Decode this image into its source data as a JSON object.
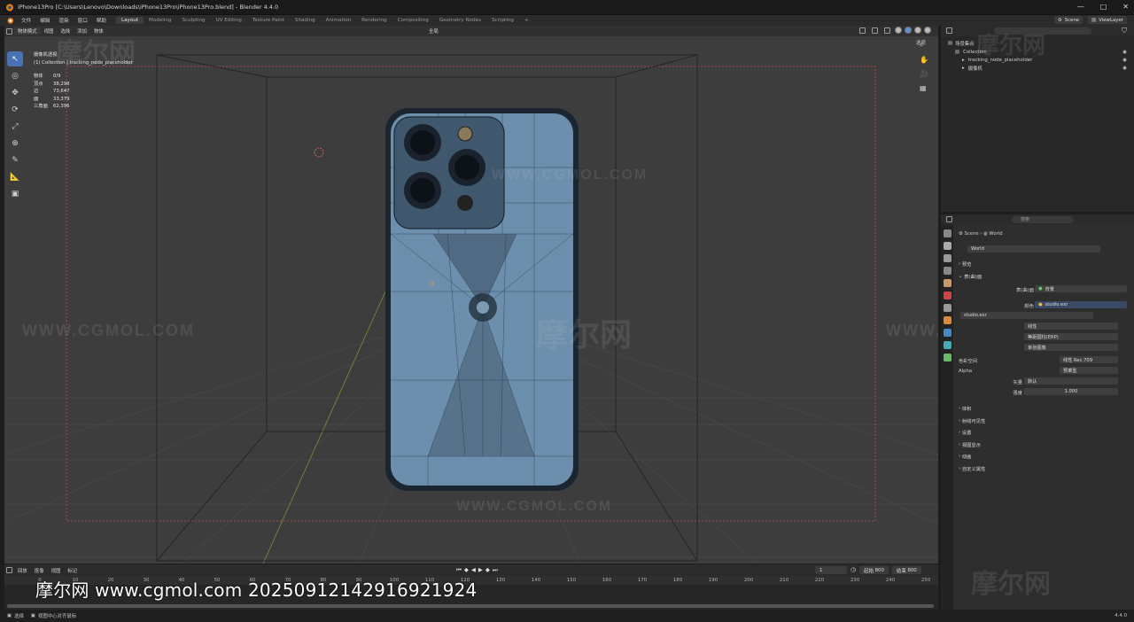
{
  "window": {
    "title": "iPhone13Pro [C:\\Users\\Lenovo\\Downloads\\iPhone13Pro\\iPhone13Pro.blend] - Blender 4.4.0",
    "controls": [
      "—",
      "□",
      "✕"
    ]
  },
  "menubar": {
    "items": [
      "文件",
      "编辑",
      "渲染",
      "窗口",
      "帮助"
    ],
    "workspaces": [
      {
        "label": "Layout",
        "active": true
      },
      {
        "label": "Modeling",
        "active": false
      },
      {
        "label": "Sculpting",
        "active": false
      },
      {
        "label": "UV Editing",
        "active": false
      },
      {
        "label": "Texture Paint",
        "active": false
      },
      {
        "label": "Shading",
        "active": false
      },
      {
        "label": "Animation",
        "active": false
      },
      {
        "label": "Rendering",
        "active": false
      },
      {
        "label": "Compositing",
        "active": false
      },
      {
        "label": "Geometry Nodes",
        "active": false
      },
      {
        "label": "Scripting",
        "active": false
      }
    ],
    "add_tab": "+",
    "scene": "Scene",
    "view_layer": "ViewLayer"
  },
  "viewport_header": {
    "mode": "物体模式",
    "menus": [
      "视图",
      "选择",
      "添加",
      "物体"
    ],
    "transform": "全局",
    "overlay_label": "选项"
  },
  "viewport_info": {
    "line1": "摄像机透视",
    "line2": "(1) Collection | tracking_node_placeholder",
    "stats": [
      {
        "k": "物体",
        "v": "0/9"
      },
      {
        "k": "顶点",
        "v": "38,298"
      },
      {
        "k": "边",
        "v": "73,647"
      },
      {
        "k": "面",
        "v": "33,379"
      },
      {
        "k": "三角面",
        "v": "62,396"
      }
    ]
  },
  "tools": [
    "select",
    "cursor",
    "move",
    "rotate",
    "scale",
    "transform",
    "annotate",
    "measure",
    "add-cube"
  ],
  "timeline": {
    "menus": [
      "回放",
      "抠像",
      "视图",
      "标记"
    ],
    "current_frame": "1",
    "start_label": "起始",
    "start": "800",
    "end_label": "结束",
    "end": "800",
    "ticks": [
      "0",
      "10",
      "20",
      "30",
      "40",
      "50",
      "60",
      "70",
      "80",
      "90",
      "100",
      "110",
      "120",
      "130",
      "140",
      "150",
      "160",
      "170",
      "180",
      "190",
      "200",
      "210",
      "220",
      "230",
      "240",
      "250"
    ]
  },
  "statusbar": {
    "select": "选择",
    "center": "视图中心对齐鼠标",
    "version": "4.4.0"
  },
  "outliner": {
    "search_hint": "",
    "root": "场景集合",
    "items": [
      {
        "label": "Collection",
        "depth": 1
      },
      {
        "label": "tracking_node_placeholder",
        "depth": 2
      },
      {
        "label": "摄像机",
        "depth": 2
      }
    ]
  },
  "properties": {
    "search_hint": "搜索",
    "breadcrumb": [
      "Scene",
      "World"
    ],
    "world_name": "World",
    "sections": {
      "preview": "预览",
      "surface": "表(曲)面",
      "volume": "体积",
      "ray_visibility": "射线可见性",
      "settings": "设置",
      "viewport_display": "视图显示",
      "animation": "动画",
      "custom_props": "自定义属性"
    },
    "surface_label": "表(曲)面",
    "surface_value": "背景",
    "color_label": "颜色",
    "color_value": "studio.exr",
    "image_name": "studio.exr",
    "interp": "线性",
    "projection": "等距圆柱(ERP)",
    "source": "单张图像",
    "colorspace_label": "色彩空间",
    "colorspace_value": "线性 Rec.709",
    "alpha_label": "Alpha",
    "alpha_value": "预乘型",
    "vector_label": "矢量",
    "vector_value": "默认",
    "strength_label": "强度",
    "strength_value": "1.000"
  },
  "watermark": {
    "text": "摩尔网 www.cgmol.com 20250912142916921924",
    "brand": "摩尔网",
    "url": "WWW.CGMOL.COM"
  },
  "colors": {
    "accent": "#4772b3",
    "mesh_fill": "#6c8fad",
    "wire": "#2a3b4a"
  }
}
